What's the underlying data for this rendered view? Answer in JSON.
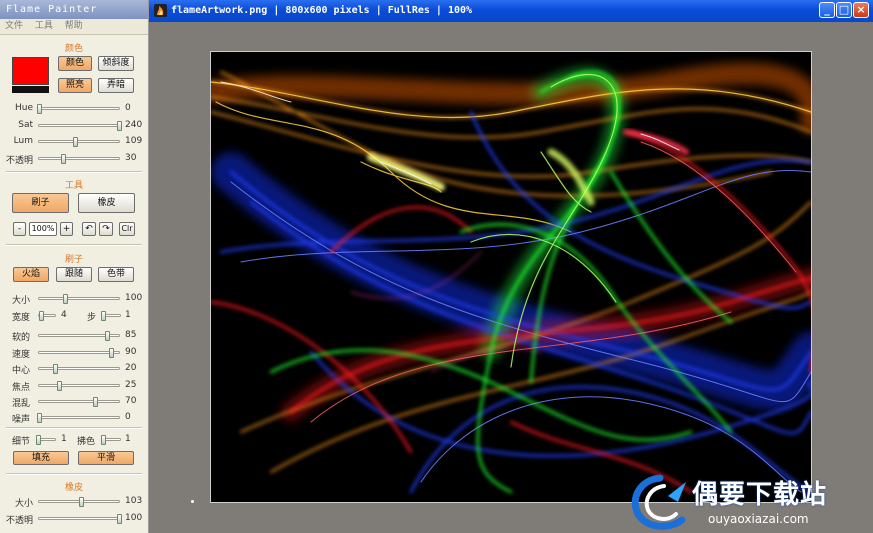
{
  "panel": {
    "title": "Flame Painter",
    "menu": [
      "文件",
      "工具",
      "帮助"
    ],
    "color_section": {
      "heading": "颜色",
      "swatch_color": "#ff0000",
      "buttons": [
        {
          "label": "颜色",
          "active": true
        },
        {
          "label": "倾斜度",
          "active": false
        },
        {
          "label": "照亮",
          "active": true
        },
        {
          "label": "弄暗",
          "active": false
        }
      ],
      "sliders": [
        {
          "label": "Hue",
          "value": "0",
          "fraction": 0.0
        },
        {
          "label": "Sat",
          "value": "240",
          "fraction": 1.0
        },
        {
          "label": "Lum",
          "value": "109",
          "fraction": 0.45
        },
        {
          "label": "不透明",
          "value": "30",
          "fraction": 0.3
        }
      ]
    },
    "tools_section": {
      "heading": "工具",
      "brush_label": "刷子",
      "eraser_label": "橡皮",
      "zoom_minus": "-",
      "zoom_value": "100%",
      "zoom_plus": "+",
      "undo": "↶",
      "redo": "↷",
      "clear": "Clr"
    },
    "brush_section": {
      "heading": "刷子",
      "modes": [
        {
          "label": "火焰",
          "active": true
        },
        {
          "label": "跟随",
          "active": false
        },
        {
          "label": "色带",
          "active": false
        }
      ],
      "size": {
        "label": "大小",
        "value": "100",
        "fraction": 0.33
      },
      "width": {
        "label": "宽度",
        "value": "4",
        "fraction": 0.1
      },
      "step": {
        "label": "步",
        "value": "1",
        "fraction": 0.05
      },
      "sliders": [
        {
          "label": "软的",
          "value": "85",
          "fraction": 0.85
        },
        {
          "label": "速度",
          "value": "90",
          "fraction": 0.9
        },
        {
          "label": "中心",
          "value": "20",
          "fraction": 0.2
        },
        {
          "label": "焦点",
          "value": "25",
          "fraction": 0.25
        },
        {
          "label": "混乱",
          "value": "70",
          "fraction": 0.7
        },
        {
          "label": "噪声",
          "value": "0",
          "fraction": 0.0
        }
      ],
      "detail": {
        "label": "细节",
        "value": "1",
        "fraction": 0.05
      },
      "pick": {
        "label": "拂色",
        "value": "1",
        "fraction": 0.05
      },
      "fill_label": "填充",
      "smooth_label": "平滑"
    },
    "eraser_section": {
      "heading": "橡皮",
      "sliders": [
        {
          "label": "大小",
          "value": "103",
          "fraction": 0.52
        },
        {
          "label": "不透明",
          "value": "100",
          "fraction": 1.0
        }
      ]
    }
  },
  "window": {
    "title": "flameArtwork.png | 800x600 pixels | FullRes | 100%",
    "controls": {
      "minimize": "_",
      "maximize": "□",
      "close": "×"
    }
  },
  "watermark": {
    "brand_cn": "偶要下载站",
    "brand_en": "ouyaoxiazai.com"
  },
  "colors": {
    "accent_orange": "#f0a866",
    "heading_orange": "#d87a2a",
    "titlebar_blue": "#0a4cd8",
    "canvas_bg": "#000000",
    "workspace_bg": "#7f7b76"
  }
}
